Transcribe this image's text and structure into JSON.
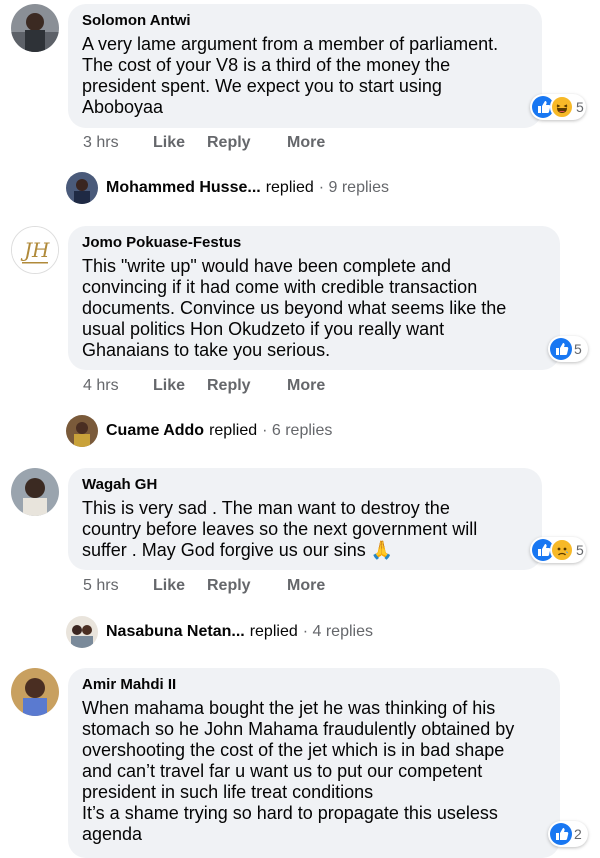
{
  "comments": [
    {
      "author": "Solomon Antwi",
      "text": "A very lame argument from a member of parliament.\nThe cost of your V8 is a third of the money the\npresident spent. We expect you to start using\nAboboyaa",
      "reaction_count": "5",
      "reactions": [
        "like",
        "haha"
      ],
      "time": "3 hrs",
      "like_label": "Like",
      "reply_label": "Reply",
      "more_label": "More",
      "reply_preview": {
        "name": "Mohammed Husse...",
        "replied": "replied",
        "count": "· 9 replies"
      }
    },
    {
      "author": "Jomo Pokuase-Festus",
      "text": "This \"write up\" would have been complete and\nconvincing if it had come with credible transaction\ndocuments. Convince us beyond what seems like the\nusual politics Hon Okudzeto if you really want\nGhanaians to take you serious.",
      "reaction_count": "5",
      "reactions": [
        "like"
      ],
      "time": "4 hrs",
      "like_label": "Like",
      "reply_label": "Reply",
      "more_label": "More",
      "reply_preview": {
        "name": "Cuame Addo",
        "replied": "replied",
        "count": "· 6 replies"
      }
    },
    {
      "author": "Wagah GH",
      "text": "This is very sad . The man want to destroy the\ncountry before leaves so the next government will\nsuffer . May God forgive us our sins 🙏",
      "reaction_count": "5",
      "reactions": [
        "like",
        "sad"
      ],
      "time": "5 hrs",
      "like_label": "Like",
      "reply_label": "Reply",
      "more_label": "More",
      "reply_preview": {
        "name": "Nasabuna Netan...",
        "replied": "replied",
        "count": "· 4 replies"
      }
    },
    {
      "author": "Amir Mahdi II",
      "text": "When mahama bought the jet he was thinking of his\nstomach so he John Mahama fraudulently obtained by\novershooting the cost of the jet which is in bad shape\nand can’t travel far u want us to put our competent\npresident in such life treat conditions\nIt’s a shame trying so hard to propagate this useless\nagenda",
      "reaction_count": "2",
      "reactions": [
        "like"
      ]
    }
  ],
  "colors": {
    "bubble": "#f0f2f5",
    "like_blue": "#1877f2",
    "secondary_text": "#65676b",
    "haha_yellow": "#f7b928"
  },
  "icons": {
    "like": "thumbs-up-icon",
    "haha": "laughing-face-icon",
    "sad": "sad-face-icon"
  }
}
